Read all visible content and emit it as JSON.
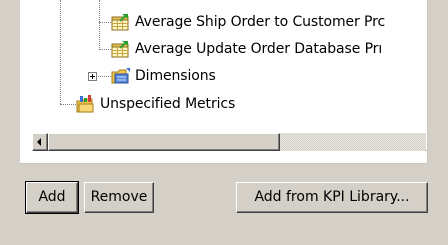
{
  "tree": {
    "items": [
      {
        "label": "Average Ship Order to Customer Prc",
        "icon": "table-chart-icon"
      },
      {
        "label": "Average Update Order Database Prı",
        "icon": "table-chart-icon"
      },
      {
        "label": "Dimensions",
        "icon": "dimension-folder-icon",
        "expandable": true,
        "expanded": false
      },
      {
        "label": "Unspecified Metrics",
        "icon": "metrics-folder-icon"
      }
    ]
  },
  "buttons": {
    "add": "Add",
    "remove": "Remove",
    "add_from_kpi": "Add from KPI Library..."
  },
  "colors": {
    "window_bg": "#d4d0c8",
    "panel_bg": "#ffffff",
    "tree_lines": "#7f7f7f"
  }
}
